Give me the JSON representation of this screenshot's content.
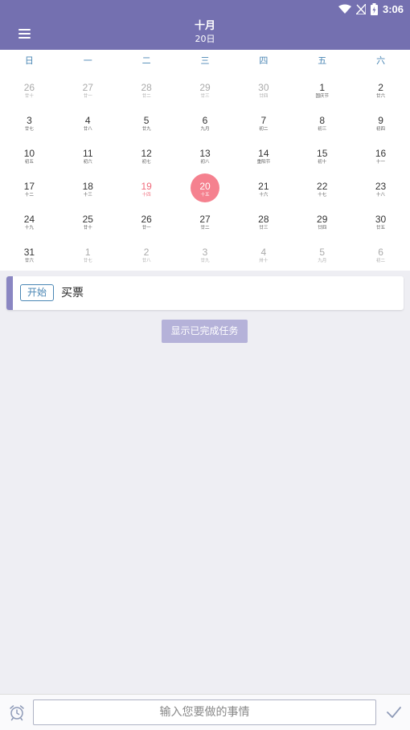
{
  "status_bar": {
    "time": "3:06",
    "icons": [
      "wifi-icon",
      "signal-off-icon",
      "battery-icon"
    ]
  },
  "header": {
    "month": "十月",
    "day": "20日",
    "menu_icon": "menu-icon"
  },
  "calendar": {
    "weekdays": [
      "日",
      "一",
      "二",
      "三",
      "四",
      "五",
      "六"
    ],
    "weeks": [
      [
        {
          "n": "26",
          "l": "廿十",
          "m": "other"
        },
        {
          "n": "27",
          "l": "廿一",
          "m": "other"
        },
        {
          "n": "28",
          "l": "廿二",
          "m": "other"
        },
        {
          "n": "29",
          "l": "廿三",
          "m": "other"
        },
        {
          "n": "30",
          "l": "廿四",
          "m": "other"
        },
        {
          "n": "1",
          "l": "国庆节",
          "m": ""
        },
        {
          "n": "2",
          "l": "廿六",
          "m": ""
        }
      ],
      [
        {
          "n": "3",
          "l": "廿七",
          "m": ""
        },
        {
          "n": "4",
          "l": "廿八",
          "m": ""
        },
        {
          "n": "5",
          "l": "廿九",
          "m": ""
        },
        {
          "n": "6",
          "l": "九月",
          "m": ""
        },
        {
          "n": "7",
          "l": "初二",
          "m": ""
        },
        {
          "n": "8",
          "l": "初三",
          "m": ""
        },
        {
          "n": "9",
          "l": "初四",
          "m": ""
        }
      ],
      [
        {
          "n": "10",
          "l": "初五",
          "m": ""
        },
        {
          "n": "11",
          "l": "初六",
          "m": ""
        },
        {
          "n": "12",
          "l": "初七",
          "m": ""
        },
        {
          "n": "13",
          "l": "初八",
          "m": ""
        },
        {
          "n": "14",
          "l": "重阳节",
          "m": ""
        },
        {
          "n": "15",
          "l": "初十",
          "m": ""
        },
        {
          "n": "16",
          "l": "十一",
          "m": ""
        }
      ],
      [
        {
          "n": "17",
          "l": "十二",
          "m": ""
        },
        {
          "n": "18",
          "l": "十三",
          "m": ""
        },
        {
          "n": "19",
          "l": "十四",
          "m": "today"
        },
        {
          "n": "20",
          "l": "十五",
          "m": "selected"
        },
        {
          "n": "21",
          "l": "十六",
          "m": ""
        },
        {
          "n": "22",
          "l": "十七",
          "m": ""
        },
        {
          "n": "23",
          "l": "十八",
          "m": ""
        }
      ],
      [
        {
          "n": "24",
          "l": "十九",
          "m": ""
        },
        {
          "n": "25",
          "l": "廿十",
          "m": ""
        },
        {
          "n": "26",
          "l": "廿一",
          "m": ""
        },
        {
          "n": "27",
          "l": "廿二",
          "m": ""
        },
        {
          "n": "28",
          "l": "廿三",
          "m": ""
        },
        {
          "n": "29",
          "l": "廿四",
          "m": ""
        },
        {
          "n": "30",
          "l": "廿五",
          "m": ""
        }
      ],
      [
        {
          "n": "31",
          "l": "廿六",
          "m": ""
        },
        {
          "n": "1",
          "l": "廿七",
          "m": "other"
        },
        {
          "n": "2",
          "l": "廿八",
          "m": "other"
        },
        {
          "n": "3",
          "l": "廿九",
          "m": "other"
        },
        {
          "n": "4",
          "l": "卅十",
          "m": "other"
        },
        {
          "n": "5",
          "l": "九月",
          "m": "other"
        },
        {
          "n": "6",
          "l": "初二",
          "m": "other"
        }
      ]
    ]
  },
  "task": {
    "start_label": "开始",
    "title": "买票"
  },
  "show_completed_label": "显示已完成任务",
  "input": {
    "placeholder": "输入您要做的事情",
    "value": ""
  },
  "colors": {
    "primary": "#7470b0",
    "accent": "#f5818f",
    "today_text": "#f06b7c",
    "link": "#4a86b4",
    "button": "#b5b2d9"
  }
}
